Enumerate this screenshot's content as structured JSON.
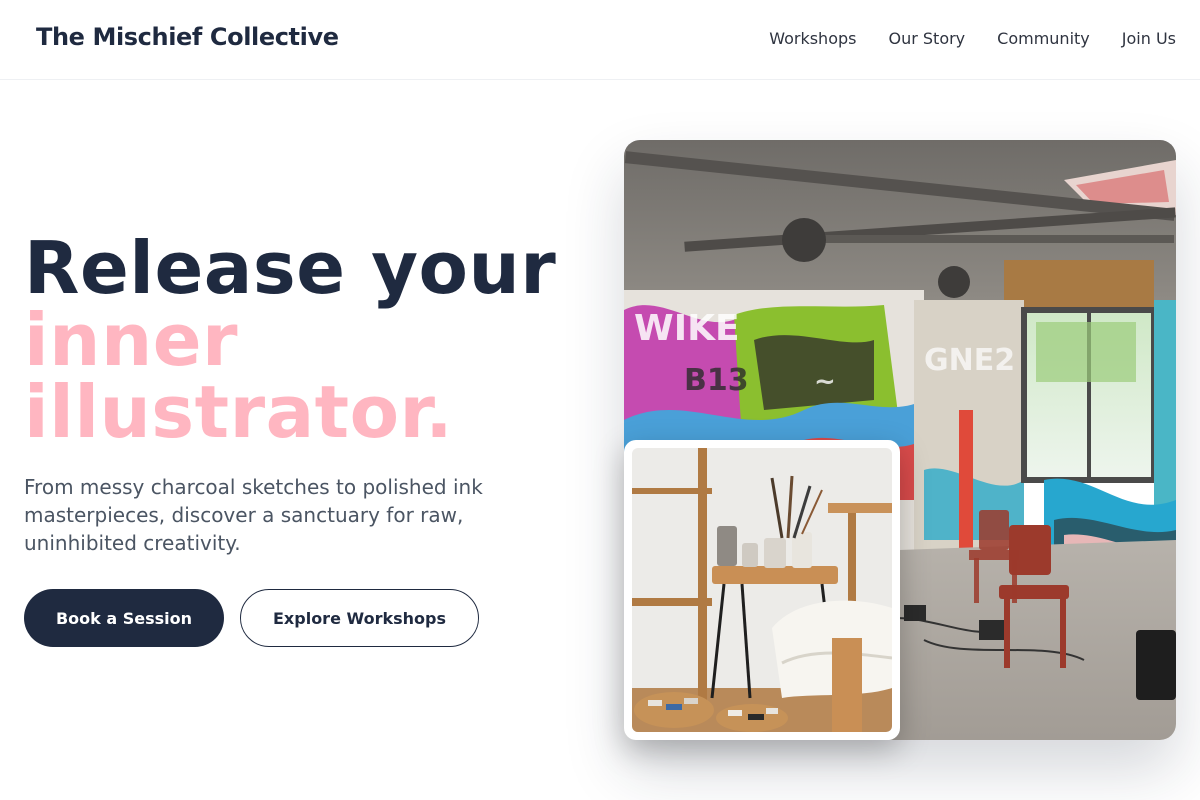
{
  "header": {
    "brand": "The Mischief Collective",
    "nav": [
      "Workshops",
      "Our Story",
      "Community",
      "Join Us"
    ]
  },
  "hero": {
    "title_line1": "Release your",
    "title_accent_1": "inner",
    "title_accent_2": "illustrator.",
    "subtitle": "From messy charcoal sketches to polished ink masterpieces, discover a sanctuary for raw, uninhibited creativity.",
    "primary_button": "Book a Session",
    "secondary_button": "Explore Workshops"
  },
  "colors": {
    "navy": "#1f2a40",
    "pink_accent": "#ffb6c1",
    "body_text": "#4b5563"
  },
  "images": {
    "main": "graffiti-studio-photo",
    "inset": "art-supplies-table-photo"
  }
}
